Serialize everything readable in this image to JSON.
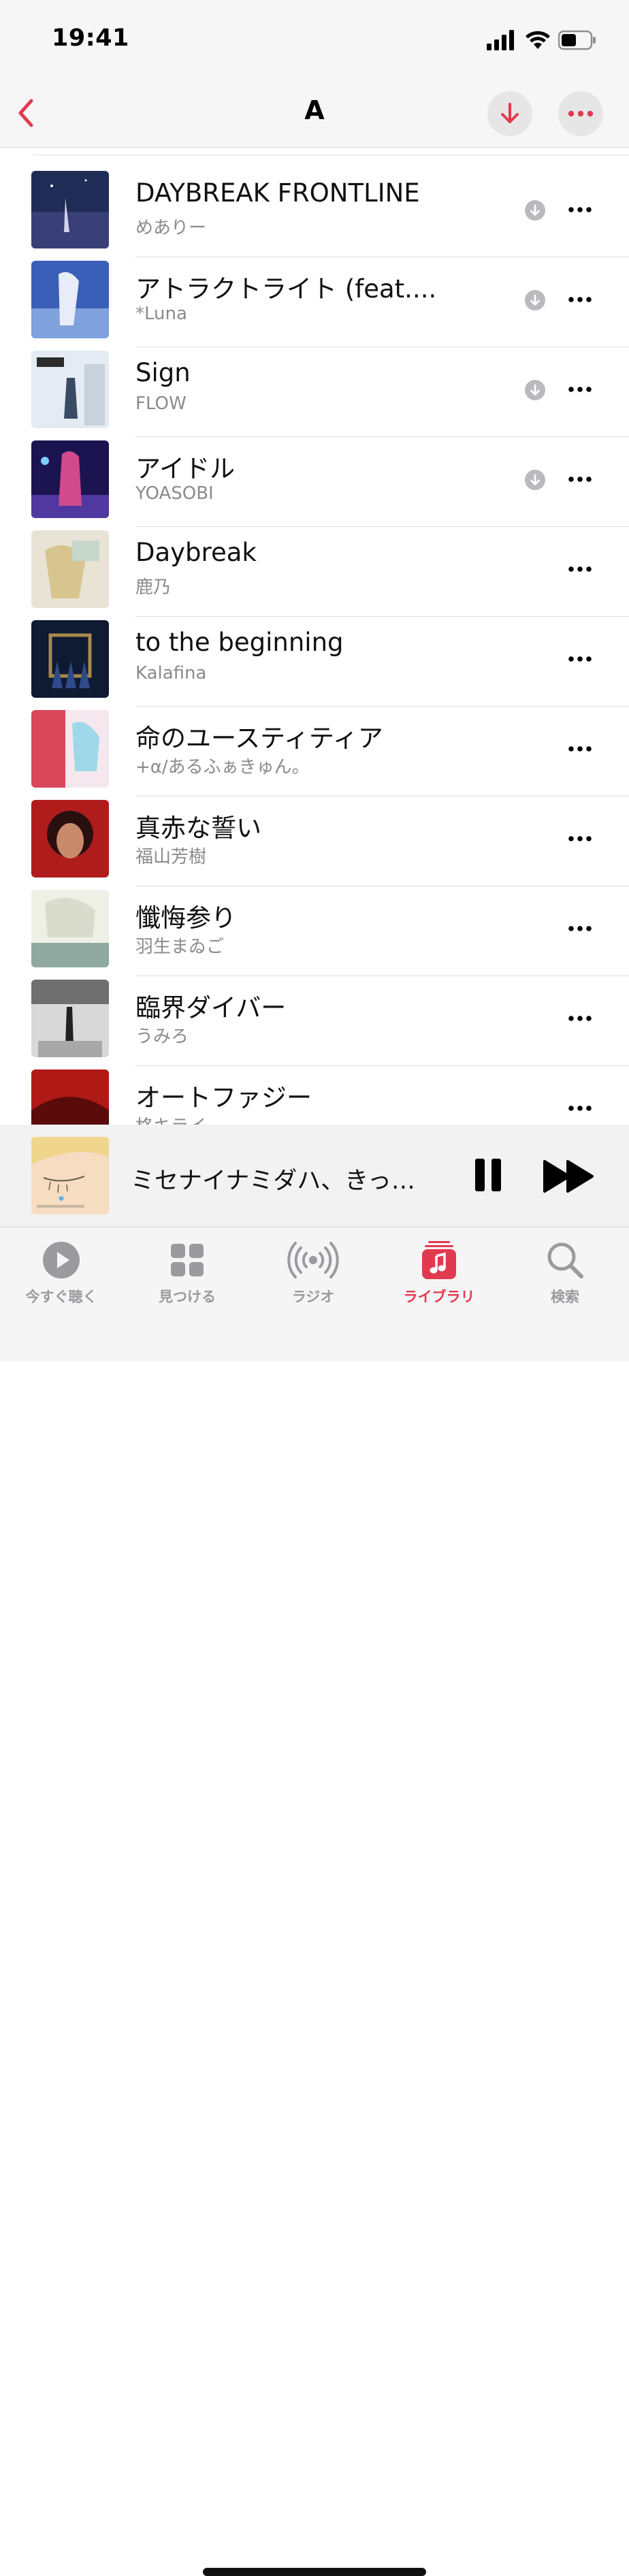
{
  "status_bar": {
    "time": "19:41"
  },
  "nav": {
    "title": "A"
  },
  "songs": [
    {
      "title": "DAYBREAK FRONTLINE",
      "artist": "めありー",
      "downloadable": true
    },
    {
      "title": "アトラクトライト (feat....",
      "artist": "*Luna",
      "downloadable": true
    },
    {
      "title": "Sign",
      "artist": "FLOW",
      "downloadable": true
    },
    {
      "title": "アイドル",
      "artist": "YOASOBI",
      "downloadable": true
    },
    {
      "title": "Daybreak",
      "artist": "鹿乃",
      "downloadable": false
    },
    {
      "title": "to the beginning",
      "artist": "Kalafina",
      "downloadable": false
    },
    {
      "title": "命のユースティティア",
      "artist": "+α/あるふぁきゅん。",
      "downloadable": false
    },
    {
      "title": "真赤な誓い",
      "artist": "福山芳樹",
      "downloadable": false
    },
    {
      "title": "懺悔参り",
      "artist": "羽生まゐご",
      "downloadable": false
    },
    {
      "title": "臨界ダイバー",
      "artist": "うみろ",
      "downloadable": false
    },
    {
      "title": "オートファジー",
      "artist": "柊キライ",
      "downloadable": false
    }
  ],
  "mini_player": {
    "title": "ミセナイナミダハ、きっ…"
  },
  "tabs": [
    {
      "label": "今すぐ聴く",
      "icon": "play-circle-icon",
      "active": false
    },
    {
      "label": "見つける",
      "icon": "grid-icon",
      "active": false
    },
    {
      "label": "ラジオ",
      "icon": "radio-icon",
      "active": false
    },
    {
      "label": "ライブラリ",
      "icon": "library-icon",
      "active": true
    },
    {
      "label": "検索",
      "icon": "search-icon",
      "active": false
    }
  ],
  "colors": {
    "accent": "#e13a4f",
    "secondary_text": "#8a8a8f",
    "inactive_tab": "#9a9a9f"
  }
}
